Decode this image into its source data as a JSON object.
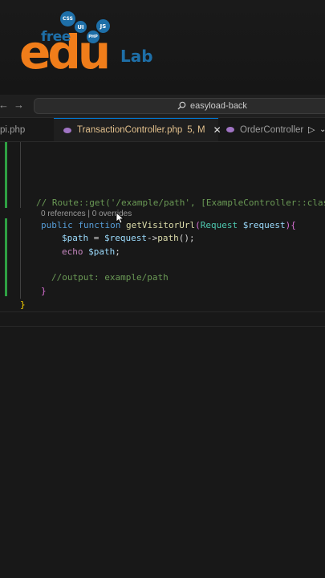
{
  "logo": {
    "word_free": "free",
    "word_edu": "edu",
    "word_lab": "Lab",
    "bubbles": [
      "CSS",
      "UI",
      "JS",
      "PHP"
    ],
    "colors": {
      "orange": "#f07d1a",
      "blue": "#1e6fa8"
    }
  },
  "nav": {
    "back_icon": "arrow-left-icon",
    "forward_icon": "arrow-right-icon",
    "search_text": "easyload-back"
  },
  "tabs": [
    {
      "label": "pi.php"
    },
    {
      "label": "TransactionController.php",
      "status": "5, M",
      "close": "✕"
    },
    {
      "label": "OrderController"
    }
  ],
  "editor": {
    "line_route": "// Route::get('/example/path', [ExampleController::class",
    "codelens": {
      "references": "0 references",
      "separator": " | ",
      "overrides": "0 overrides"
    },
    "line_sig": {
      "kw_public": "public",
      "kw_function": "function",
      "fn_name": "getVisitorUrl",
      "paren_open": "(",
      "type": "Request",
      "param": "$request",
      "paren_close": ")",
      "brace": "{"
    },
    "line_path": {
      "var": "$path",
      "eq": " = ",
      "obj": "$request",
      "arrow": "->",
      "method": "path",
      "end": "();"
    },
    "line_echo": {
      "kw": "echo",
      "var": "$path",
      "end": ";"
    },
    "line_output": "//output: example/path",
    "close_inner": "}",
    "close_outer": "}"
  },
  "theme": {
    "accent": "#0078d4",
    "modified": "#e2c08d",
    "gutter_added": "#2ea043"
  }
}
